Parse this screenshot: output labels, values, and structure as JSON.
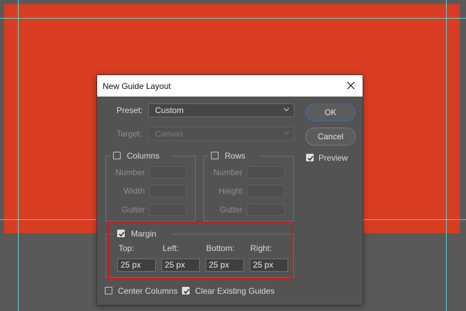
{
  "dialog": {
    "title": "New Guide Layout",
    "preset_label": "Preset:",
    "preset_value": "Custom",
    "target_label": "Target:",
    "target_value": "Canvas",
    "ok_label": "OK",
    "cancel_label": "Cancel",
    "preview_label": "Preview",
    "preview_checked": true,
    "columns": {
      "label": "Columns",
      "checked": false,
      "fields": [
        "Number",
        "Width",
        "Gutter"
      ]
    },
    "rows": {
      "label": "Rows",
      "checked": false,
      "fields": [
        "Number",
        "Height",
        "Gutter"
      ]
    },
    "margin": {
      "label": "Margin",
      "checked": true,
      "top_label": "Top:",
      "left_label": "Left:",
      "bottom_label": "Bottom:",
      "right_label": "Right:",
      "top_value": "25 px",
      "left_value": "25 px",
      "bottom_value": "25 px",
      "right_value": "25 px"
    },
    "center_columns_label": "Center Columns",
    "center_columns_checked": false,
    "clear_guides_label": "Clear Existing Guides",
    "clear_guides_checked": true
  },
  "colors": {
    "canvas": "#d93d22",
    "background": "#595959",
    "guide": "#5ad6d6",
    "dialog": "#535353",
    "ok_border": "#2d6fd1",
    "highlight": "#d4161e"
  }
}
